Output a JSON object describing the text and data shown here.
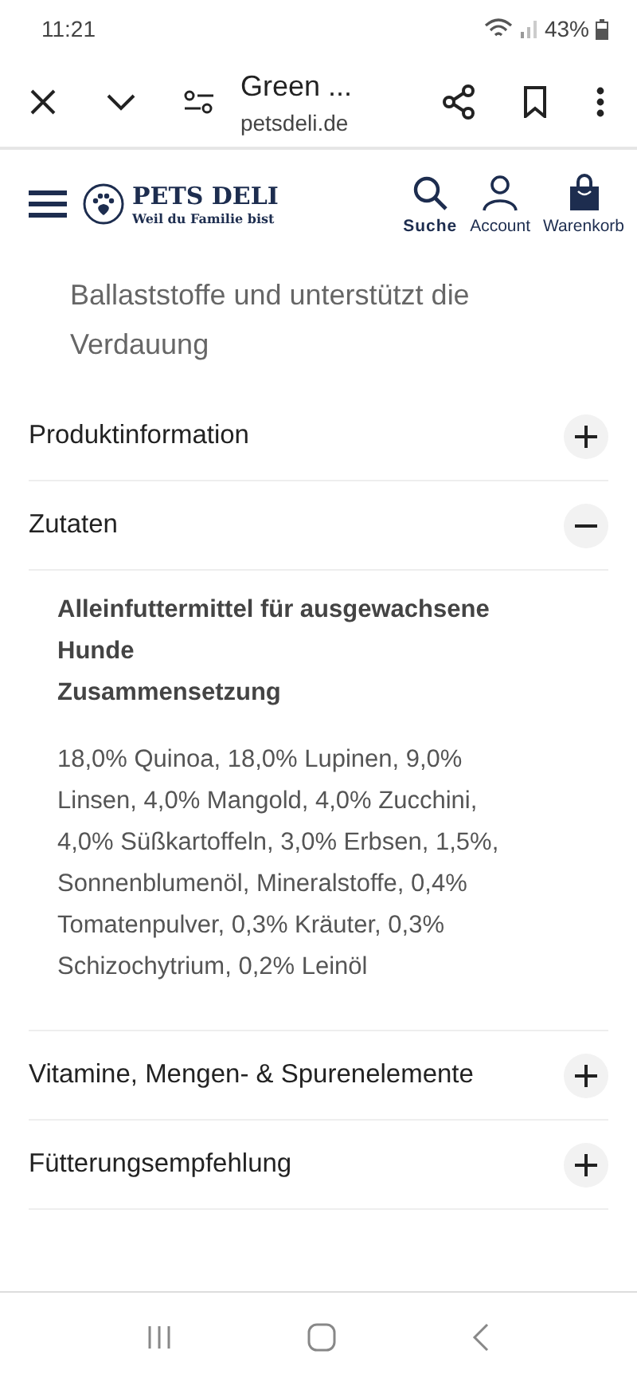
{
  "status_bar": {
    "time": "11:21",
    "battery": "43%"
  },
  "browser_bar": {
    "title": "Green ...",
    "url": "petsdeli.de"
  },
  "site_header": {
    "logo_name": "PETS DELI",
    "logo_tagline": "Weil du Familie bist",
    "actions": [
      {
        "label": "Suche",
        "kind": "search",
        "selected": true
      },
      {
        "label": "Account",
        "kind": "account",
        "selected": false
      },
      {
        "label": "Warenkorb",
        "kind": "cart",
        "selected": false
      }
    ]
  },
  "intro_text": "Ballaststoffe und unterstützt die Verdauung",
  "accordion": [
    {
      "title": "Produktinformation",
      "expanded": false
    },
    {
      "title": "Zutaten",
      "expanded": true,
      "heading": "Alleinfuttermittel für ausgewachsene Hunde",
      "subheading": "Zusammensetzung",
      "body": "18,0% Quinoa, 18,0% Lupinen, 9,0% Linsen, 4,0% Mangold, 4,0% Zucchini, 4,0% Süßkartoffeln, 3,0% Erbsen, 1,5%, Sonnenblumenöl, Mineralstoffe, 0,4% Tomatenpulver, 0,3% Kräuter, 0,3% Schizochytrium, 0,2% Leinöl"
    },
    {
      "title": "Vitamine, Mengen- & Spurenelemente",
      "expanded": false
    },
    {
      "title": "Fütterungsempfehlung",
      "expanded": false
    }
  ]
}
